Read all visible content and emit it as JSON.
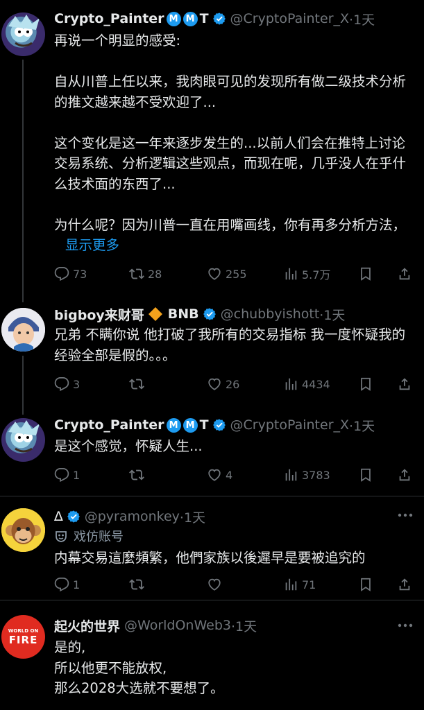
{
  "tweets": [
    {
      "name": "Crypto_Painter",
      "badges": [
        "M",
        "M",
        "T"
      ],
      "handle": "@CryptoPainter_X",
      "time": "·1天",
      "text": "再说一个明显的感受:\n\n自从川普上任以来，我肉眼可见的发现所有做二级技术分析的推文越来越不受欢迎了...\n\n这个变化是这一年来逐步发生的...以前人们会在推特上讨论交易系统、分析逻辑这些观点，而现在呢，几乎没人在乎什么技术面的东西了...\n\n为什么呢？因为川普一直在用嘴画线，你有再多分析方法，",
      "show_more": "显示更多",
      "replies": "73",
      "retweets": "28",
      "likes": "255",
      "views": "5.7万"
    },
    {
      "name": "bigboy来财哥",
      "suffix": "BNB",
      "handle": "@chubbyishott",
      "time": "·1天",
      "text": "兄弟 不瞒你说 他打破了我所有的交易指标 我一度怀疑我的经验全部是假的。。。",
      "replies": "3",
      "retweets": "",
      "likes": "26",
      "views": "4434"
    },
    {
      "name": "Crypto_Painter",
      "badges": [
        "M",
        "M",
        "T"
      ],
      "handle": "@CryptoPainter_X",
      "time": "·1天",
      "text": "是这个感觉，怀疑人生...",
      "replies": "1",
      "retweets": "",
      "likes": "4",
      "views": "3783"
    },
    {
      "name": "∆",
      "handle": "@pyramonkey",
      "time": "·1天",
      "parody_label": "戏仿账号",
      "text": "内幕交易這麼頻繁，他們家族以後遲早是要被追究的",
      "replies": "1",
      "retweets": "",
      "likes": "",
      "views": "71"
    },
    {
      "name": "起火的世界",
      "handle": "@WorldOnWeb3",
      "time": "·1天",
      "text": "是的,\n所以他更不能放权,\n那么2028大选就不要想了。",
      "avatar_text": [
        "WORLD ON",
        "FIRE"
      ]
    }
  ],
  "colors": {
    "accent": "#1d9bf0",
    "muted": "#71767b",
    "background": "#000000"
  }
}
